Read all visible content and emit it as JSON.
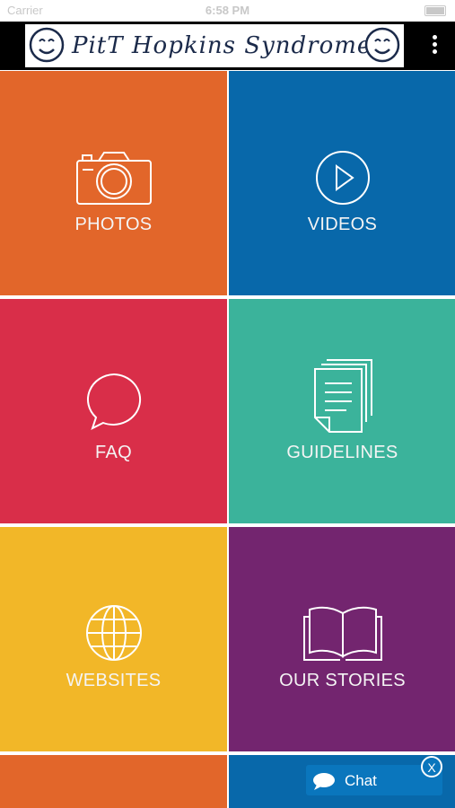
{
  "status_bar": {
    "carrier": "Carrier",
    "time": "6:58 PM"
  },
  "header": {
    "title": "PitT Hopkins Syndrome",
    "menu_icon": "more-vert-icon"
  },
  "tiles": [
    {
      "label": "PHOTOS",
      "icon": "camera-icon",
      "color": "#e2662a"
    },
    {
      "label": "VIDEOS",
      "icon": "play-circle-icon",
      "color": "#0868aa"
    },
    {
      "label": "FAQ",
      "icon": "speech-bubble-icon",
      "color": "#d92e49"
    },
    {
      "label": "GUIDELINES",
      "icon": "document-icon",
      "color": "#3bb39b"
    },
    {
      "label": "WEBSITES",
      "icon": "globe-icon",
      "color": "#f2b728"
    },
    {
      "label": "OUR STORIES",
      "icon": "open-book-icon",
      "color": "#73256f"
    }
  ],
  "chat": {
    "label": "Chat",
    "close": "X",
    "color": "#0a76bd"
  }
}
